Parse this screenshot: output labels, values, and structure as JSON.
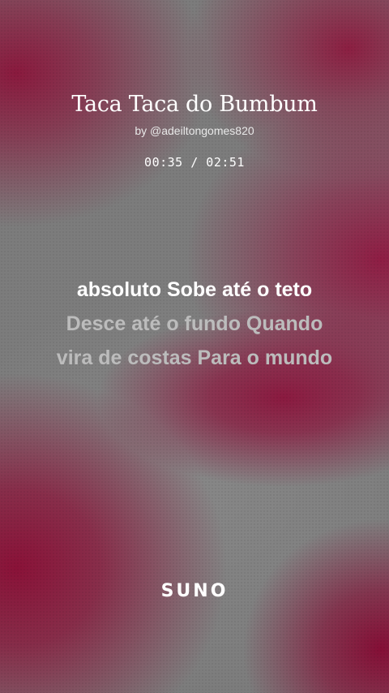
{
  "song": {
    "title": "Taca Taca do Bumbum",
    "byline": "by @adeiltongomes820"
  },
  "playback": {
    "time_display": "00:35 / 02:51",
    "current_time": "00:35",
    "total_time": "02:51"
  },
  "lyrics": {
    "lines": [
      {
        "text": "absoluto Sobe até o teto",
        "state": "active"
      },
      {
        "text": "Desce até o fundo Quando",
        "state": "upcoming"
      },
      {
        "text": "vira de costas Para o mundo",
        "state": "upcoming"
      }
    ]
  },
  "brand": {
    "logo_text": "SUNO"
  },
  "colors": {
    "background_accent": "#8a1a3e",
    "background_base": "#7c7c7c",
    "active_lyric": "#ffffff",
    "upcoming_lyric": "#bcbcbc"
  }
}
